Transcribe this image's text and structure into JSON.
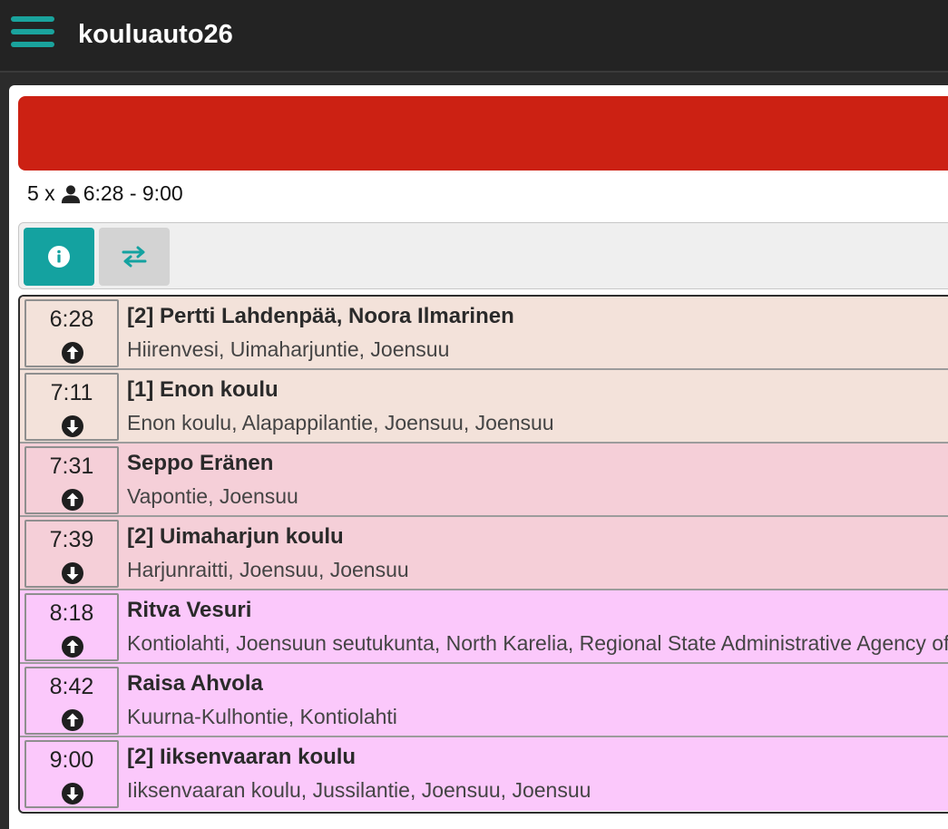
{
  "header": {
    "title": "kouluauto26"
  },
  "summary": {
    "count": "5 x",
    "time_range": "6:28 - 9:00"
  },
  "colors": {
    "accent": "#14a2a0",
    "banner": "#cc2113",
    "row_beige": "#f3e2da",
    "row_pink": "#f5cfd8",
    "row_magenta": "#fbc8fb"
  },
  "tabs": [
    {
      "icon": "info-icon",
      "active": true
    },
    {
      "icon": "swap-arrows-icon",
      "active": false
    }
  ],
  "stops": [
    {
      "time": "6:28",
      "direction": "pickup",
      "name": "[2] Pertti Lahdenpää, Noora Ilmarinen",
      "address": "Hiirenvesi, Uimaharjuntie, Joensuu",
      "color": "#f3e2da"
    },
    {
      "time": "7:11",
      "direction": "dropoff",
      "name": "[1] Enon koulu",
      "address": "Enon koulu, Alapappilantie, Joensuu, Joensuu",
      "color": "#f3e2da"
    },
    {
      "time": "7:31",
      "direction": "pickup",
      "name": "Seppo Eränen",
      "address": "Vapontie, Joensuu",
      "color": "#f5cfd8"
    },
    {
      "time": "7:39",
      "direction": "dropoff",
      "name": "[2] Uimaharjun koulu",
      "address": "Harjunraitti, Joensuu, Joensuu",
      "color": "#f5cfd8"
    },
    {
      "time": "8:18",
      "direction": "pickup",
      "name": "Ritva Vesuri",
      "address": "Kontiolahti, Joensuun seutukunta, North Karelia, Regional State Administrative Agency of Eastern Finland, Finland",
      "color": "#fbc8fb"
    },
    {
      "time": "8:42",
      "direction": "pickup",
      "name": "Raisa Ahvola",
      "address": "Kuurna-Kulhontie, Kontiolahti",
      "color": "#fbc8fb"
    },
    {
      "time": "9:00",
      "direction": "dropoff",
      "name": "[2] Iiksenvaaran koulu",
      "address": "Iiksenvaaran koulu, Jussilantie, Joensuu, Joensuu",
      "color": "#fbc8fb"
    }
  ]
}
